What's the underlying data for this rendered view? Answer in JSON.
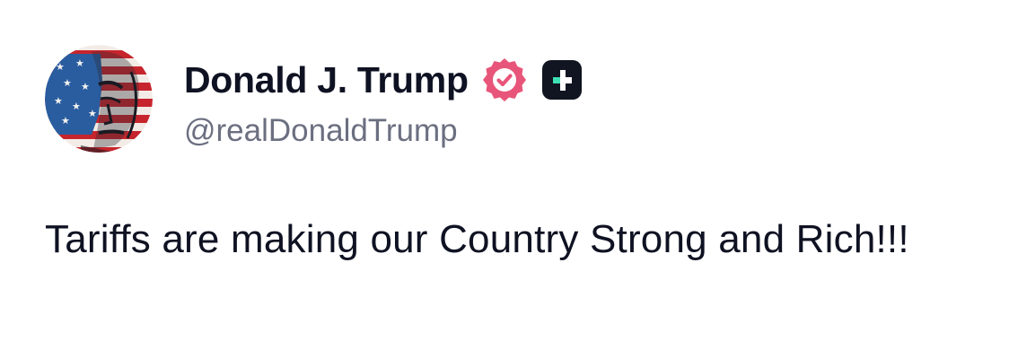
{
  "author": {
    "display_name": "Donald J. Trump",
    "handle": "@realDonaldTrump",
    "avatar_icon": "flag-portrait-avatar",
    "verified_icon": "verified-badge-icon",
    "plus_icon": "plus-badge-icon"
  },
  "post": {
    "text": "Tariffs are making our Country Strong and Rich!!!"
  },
  "colors": {
    "text_primary": "#0f1222",
    "text_secondary": "#6b6f80",
    "verified_badge": "#e8557a",
    "plus_badge_bg": "#111421",
    "plus_badge_accent": "#3ee0b4"
  }
}
